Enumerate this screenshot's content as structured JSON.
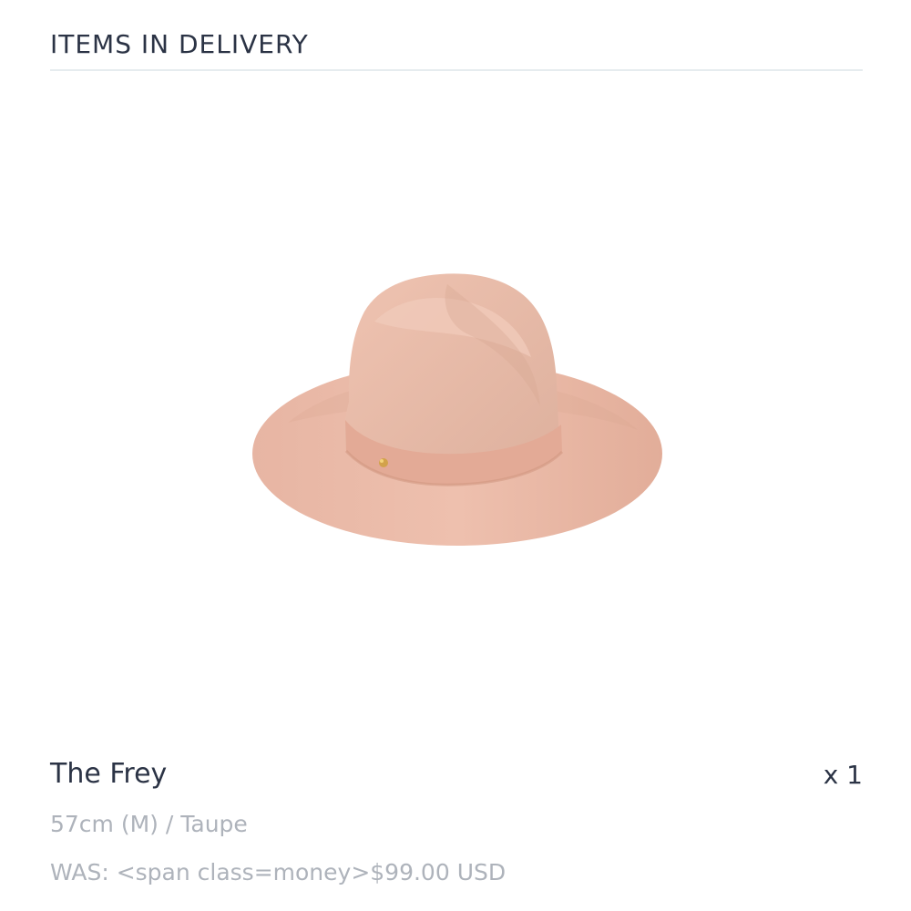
{
  "section": {
    "title": "ITEMS IN DELIVERY"
  },
  "product": {
    "image_icon": "hat-product-image",
    "name": "The Frey",
    "quantity": "x 1",
    "variant": "57cm (M) / Taupe",
    "price": "WAS: <span class=money>$99.00 USD"
  },
  "colors": {
    "title_text": "#2b3345",
    "muted_text": "#aeb3bb",
    "divider": "#e6ecef",
    "hat_main": "#e8b9a6",
    "hat_shadow": "#d9a48f",
    "hat_band": "#e4ac98",
    "button_accent": "#d2a24b"
  }
}
